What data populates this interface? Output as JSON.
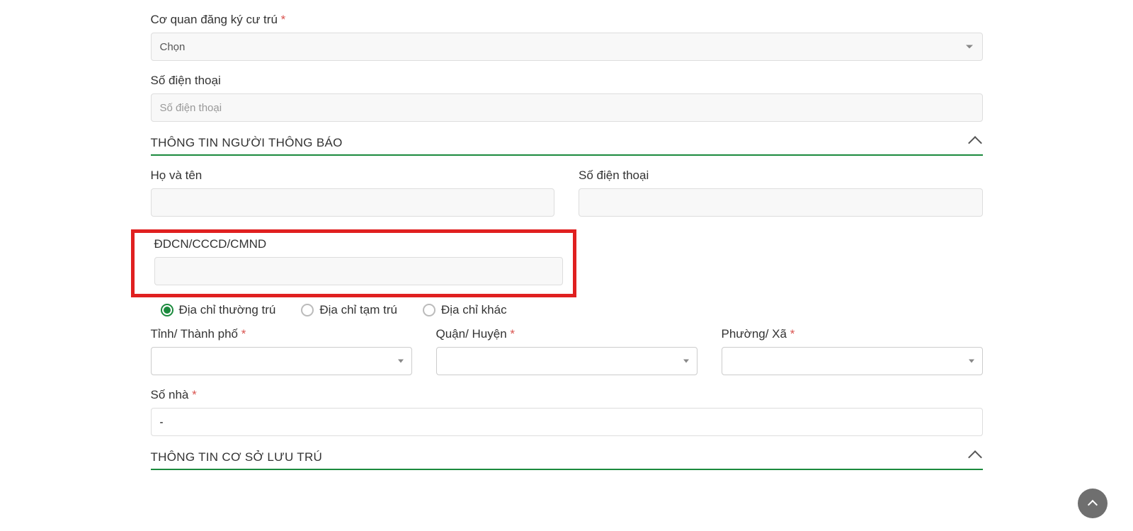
{
  "top": {
    "agency_label": "Cơ quan đăng ký cư trú",
    "agency_value": "Chọn",
    "phone_label": "Số điện thoại",
    "phone_placeholder": "Số điện thoại"
  },
  "section_reporter": {
    "title": "THÔNG TIN NGƯỜI THÔNG BÁO",
    "fullname_label": "Họ và tên",
    "phone_label": "Số điện thoại",
    "id_label": "ĐDCN/CCCD/CMND",
    "radios": {
      "permanent": "Địa chỉ thường trú",
      "temporary": "Địa chỉ tạm trú",
      "other": "Địa chỉ khác"
    },
    "province_label": "Tỉnh/ Thành phố",
    "district_label": "Quận/ Huyện",
    "ward_label": "Phường/ Xã",
    "house_label": "Số nhà",
    "house_value": "-"
  },
  "section_accommodation": {
    "title": "THÔNG TIN CƠ SỞ LƯU TRÚ"
  },
  "asterisk": "*"
}
